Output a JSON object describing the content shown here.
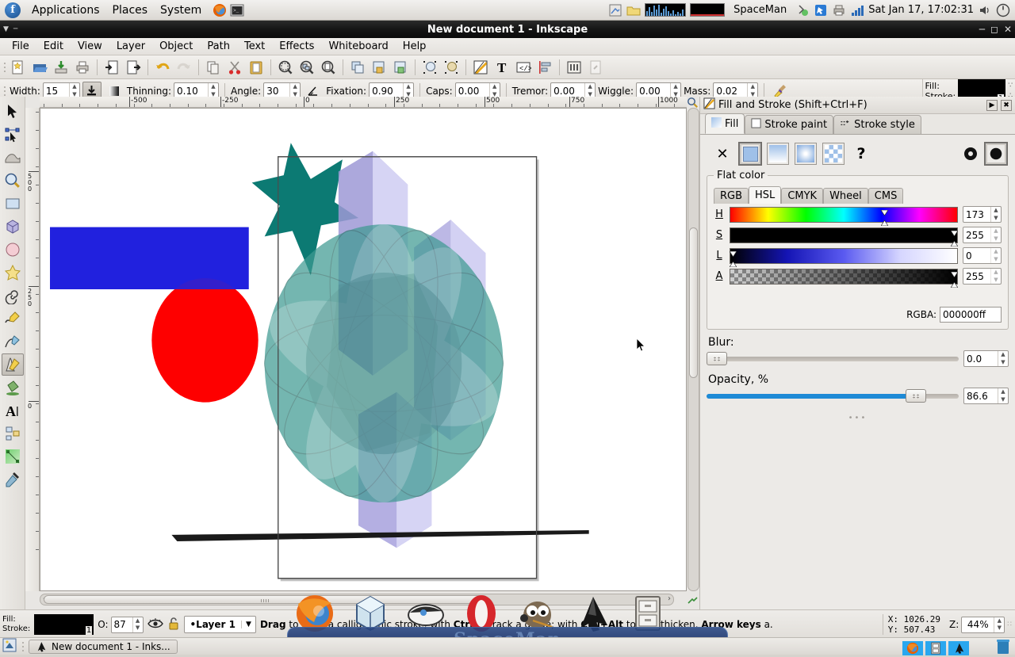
{
  "gnome_panel": {
    "menus": [
      "Applications",
      "Places",
      "System"
    ],
    "launchers": [
      "firefox-icon",
      "terminal-icon"
    ],
    "app_indicator": "SpaceMan",
    "tray_icons": [
      "screenshot-icon",
      "folder-icon",
      "cpu-graph-icon",
      "net-graph-icon",
      "bluetooth-icon",
      "mouse-icon",
      "printer-icon",
      "network-signal-icon"
    ],
    "clock": "Sat Jan 17, 17:02:31",
    "volume_icon": "speaker-icon",
    "power_icon": "power-icon"
  },
  "window": {
    "title": "New document 1 - Inkscape",
    "buttons": [
      "minimize",
      "maximize",
      "close"
    ]
  },
  "menubar": [
    "File",
    "Edit",
    "View",
    "Layer",
    "Object",
    "Path",
    "Text",
    "Effects",
    "Whiteboard",
    "Help"
  ],
  "commandbar": [
    "new-document-icon",
    "open-document-icon",
    "save-document-icon",
    "print-icon",
    "import-icon",
    "export-icon",
    "undo-icon",
    "redo-icon",
    "copy-icon",
    "cut-icon",
    "paste-icon",
    "zoom-selection-icon",
    "zoom-drawing-icon",
    "zoom-page-icon",
    "duplicate-icon",
    "group-icon",
    "ungroup-icon",
    "raise-selection-icon",
    "lower-selection-icon",
    "fill-stroke-icon",
    "text-properties-icon",
    "xml-editor-icon",
    "align-distribute-icon",
    "preferences-icon",
    "document-properties-icon"
  ],
  "tool_options": {
    "width": {
      "label": "Width:",
      "value": "15"
    },
    "pressure_toggle": "pressure-icon",
    "trace_background": "trace-background-icon",
    "thinning": {
      "label": "Thinning:",
      "value": "0.10"
    },
    "angle": {
      "label": "Angle:",
      "value": "30"
    },
    "tilt": "tilt-icon",
    "fixation": {
      "label": "Fixation:",
      "value": "0.90"
    },
    "caps": {
      "label": "Caps:",
      "value": "0.00"
    },
    "tremor": {
      "label": "Tremor:",
      "value": "0.00"
    },
    "wiggle": {
      "label": "Wiggle:",
      "value": "0.00"
    },
    "mass": {
      "label": "Mass:",
      "value": "0.02"
    },
    "reset_icon": "broom-icon"
  },
  "style_indicator": {
    "fill_label": "Fill:",
    "stroke_label": "Stroke:",
    "fill_color": "#000000",
    "stroke_width": "1"
  },
  "toolbox": [
    {
      "name": "selector-tool",
      "icon": "arrow-pointer-icon",
      "selected": false
    },
    {
      "name": "node-tool",
      "icon": "node-editor-icon",
      "selected": false
    },
    {
      "name": "tweak-tool",
      "icon": "tweak-icon",
      "selected": false
    },
    {
      "name": "zoom-tool",
      "icon": "magnifier-icon",
      "selected": false
    },
    {
      "name": "rectangle-tool",
      "icon": "rectangle-icon",
      "selected": false
    },
    {
      "name": "3dbox-tool",
      "icon": "cube-icon",
      "selected": false
    },
    {
      "name": "ellipse-tool",
      "icon": "ellipse-icon",
      "selected": false
    },
    {
      "name": "star-tool",
      "icon": "star-icon",
      "selected": false
    },
    {
      "name": "spiral-tool",
      "icon": "spiral-icon",
      "selected": false
    },
    {
      "name": "pencil-tool",
      "icon": "pencil-icon",
      "selected": false
    },
    {
      "name": "bezier-tool",
      "icon": "pen-icon",
      "selected": false
    },
    {
      "name": "calligraphy-tool",
      "icon": "calligraphy-pen-icon",
      "selected": true
    },
    {
      "name": "paint-bucket-tool",
      "icon": "paint-bucket-icon",
      "selected": false
    },
    {
      "name": "text-tool",
      "icon": "text-a-icon",
      "selected": false
    },
    {
      "name": "connector-tool",
      "icon": "connector-icon",
      "selected": false
    },
    {
      "name": "gradient-tool",
      "icon": "gradient-icon",
      "selected": false
    },
    {
      "name": "dropper-tool",
      "icon": "eyedropper-icon",
      "selected": false
    }
  ],
  "rulers": {
    "h_labels": [
      "-500",
      "-250",
      "0",
      "250",
      "500",
      "750",
      "1000"
    ],
    "v_labels": [
      "500",
      "250",
      "0"
    ],
    "unit_icon": "zoom-unit-icon"
  },
  "canvas": {
    "page_border": true,
    "shapes": [
      {
        "name": "teal-star",
        "fill": "#0c7a73"
      },
      {
        "name": "blue-rectangle",
        "fill": "#2222dd"
      },
      {
        "name": "red-circle",
        "fill": "#fe0000"
      },
      {
        "name": "lavender-3d-box",
        "fill": "#9a96d8"
      },
      {
        "name": "teal-translucent-sphere",
        "fill": "#3f9a92"
      },
      {
        "name": "black-calligraphic-stroke",
        "fill": "#1a1a1a"
      }
    ]
  },
  "fill_stroke_dialog": {
    "title": "Fill and Stroke (Shift+Ctrl+F)",
    "header_buttons": [
      "iconify-icon",
      "close-icon"
    ],
    "tabs": [
      {
        "label": "Fill",
        "icon": "fill-swatch-icon",
        "active": true
      },
      {
        "label": "Stroke paint",
        "icon": "stroke-paint-icon",
        "active": false
      },
      {
        "label": "Stroke style",
        "icon": "stroke-style-icon",
        "active": false
      }
    ],
    "paint_buttons": [
      {
        "name": "no-paint-button",
        "icon": "x-icon",
        "selected": false
      },
      {
        "name": "flat-color-button",
        "icon": "flat-color-icon",
        "selected": true
      },
      {
        "name": "linear-gradient-button",
        "icon": "linear-gradient-icon",
        "selected": false
      },
      {
        "name": "radial-gradient-button",
        "icon": "radial-gradient-icon",
        "selected": false
      },
      {
        "name": "pattern-button",
        "icon": "pattern-icon",
        "selected": false
      },
      {
        "name": "unknown-paint-button",
        "icon": "question-mark-icon",
        "selected": false
      }
    ],
    "fill_rule_buttons": [
      {
        "name": "evenodd-fillrule-button",
        "icon": "evenodd-icon",
        "selected": false
      },
      {
        "name": "nonzero-fillrule-button",
        "icon": "nonzero-icon",
        "selected": true
      }
    ],
    "group_label": "Flat color",
    "color_tabs": [
      {
        "label": "RGB",
        "active": false
      },
      {
        "label": "HSL",
        "active": true
      },
      {
        "label": "CMYK",
        "active": false
      },
      {
        "label": "Wheel",
        "active": false
      },
      {
        "label": "CMS",
        "active": false
      }
    ],
    "channels": [
      {
        "label": "H",
        "value": "173",
        "percent": 68
      },
      {
        "label": "S",
        "value": "255",
        "percent": 100
      },
      {
        "label": "L",
        "value": "0",
        "percent": 0
      },
      {
        "label": "A",
        "value": "255",
        "percent": 100
      }
    ],
    "rgba_label": "RGBA:",
    "rgba_value": "000000ff",
    "blur_label": "Blur:",
    "blur_value": "0.0",
    "blur_percent": 0,
    "opacity_label": "Opacity, %",
    "opacity_value": "86.6",
    "opacity_percent": 86.6
  },
  "statusbar": {
    "fill_label": "Fill:",
    "stroke_label": "Stroke:",
    "stroke_width": "1",
    "opacity_label": "O:",
    "opacity_value": "87",
    "visibility_icon": "eye-icon",
    "lock_icon": "unlocked-icon",
    "layer_name": "•Layer 1",
    "layer_dropdown_icon": "chevron-down-icon",
    "message": "Drag to draw a calligraphic stroke; with Ctrl to track a guide; with Ctrl+Alt to thin/thicken. Arrow keys a.",
    "message_parts": [
      {
        "text": "Drag",
        "bold": true
      },
      {
        "text": " to draw a calligraphic stroke; with ",
        "bold": false
      },
      {
        "text": "Ctrl",
        "bold": true
      },
      {
        "text": " to track a guide; with ",
        "bold": false
      },
      {
        "text": "Ctrl+Alt",
        "bold": true
      },
      {
        "text": " to thin/thicken. ",
        "bold": false
      },
      {
        "text": "Arrow keys",
        "bold": true
      },
      {
        "text": " a.",
        "bold": false
      }
    ],
    "x_label": "X:",
    "x_value": "1026.29",
    "y_label": "Y:",
    "y_value": "507.43",
    "zoom_label": "Z:",
    "zoom_value": "44%"
  },
  "taskbar": {
    "show_desktop_icon": "show-desktop-icon",
    "tasks": [
      {
        "icon": "inkscape-icon",
        "label": "New document 1 - Inks..."
      }
    ],
    "tray": [
      "firefox-icon",
      "files-icon",
      "inkscape-icon",
      "trash-icon"
    ]
  },
  "dock": {
    "items": [
      "firefox-icon",
      "virtualbox-icon",
      "mouse-icon",
      "opera-icon",
      "gimp-icon",
      "inkscape-icon",
      "filecabinet-icon"
    ],
    "watermark": "SpaceMan"
  },
  "palette_colors": [
    "#000000",
    "#0d0d0d",
    "#1a1a1a",
    "#262626",
    "#333333",
    "#404040",
    "#4d4d4d",
    "#595959",
    "#666666",
    "#737373",
    "#808080",
    "#8c8c8c",
    "#999999",
    "#a6a6a6",
    "#b3b3b3",
    "#bfbfbf",
    "#cccccc",
    "#d9d9d9",
    "#e6e6e6",
    "#f2f2f2",
    "#ffffff",
    "#800000",
    "#ff0000",
    "#808000",
    "#ffff00",
    "#008000",
    "#00ff00",
    "#008080",
    "#00ffff",
    "#000080",
    "#0000ff",
    "#800080",
    "#ff00ff",
    "#2b0000",
    "#4a0000",
    "#6b0000",
    "#8f0000",
    "#b50000",
    "#d60000",
    "#f50000",
    "#ff2b2b",
    "#ff5555",
    "#ff8080",
    "#ffaaaa",
    "#ffd4d4",
    "#1b0808",
    "#3a1414",
    "#5a1f1f",
    "#7a2a2a",
    "#9a3636",
    "#b84a4a",
    "#cd6a6a",
    "#dd8b8b",
    "#e8a9a9",
    "#f2c6c6",
    "#f8dede",
    "#14101c",
    "#2a2440",
    "#413a63",
    "#584f85",
    "#6f66a4",
    "#8a82b8",
    "#a49ecb",
    "#bcb8da",
    "#d2cfe6",
    "#e6e4f1",
    "#3d1a00",
    "#5e2a00",
    "#803a00",
    "#a14b00",
    "#c25c00",
    "#e06f05",
    "#f0831f",
    "#f79a45",
    "#fbb171",
    "#fdc79c",
    "#fedcc4",
    "#ffefe2",
    "#2a1708",
    "#482712",
    "#66371c",
    "#854827",
    "#a35a33",
    "#bb7048",
    "#cc8a68",
    "#d9a58d",
    "#e4bfb1",
    "#efd9d1",
    "#1c1410",
    "#332a22",
    "#4d4035",
    "#675648",
    "#816c5c",
    "#9b8372",
    "#b59b8d",
    "#cdb5a9",
    "#e0cdc4",
    "#efe1db",
    "#ffffff"
  ]
}
